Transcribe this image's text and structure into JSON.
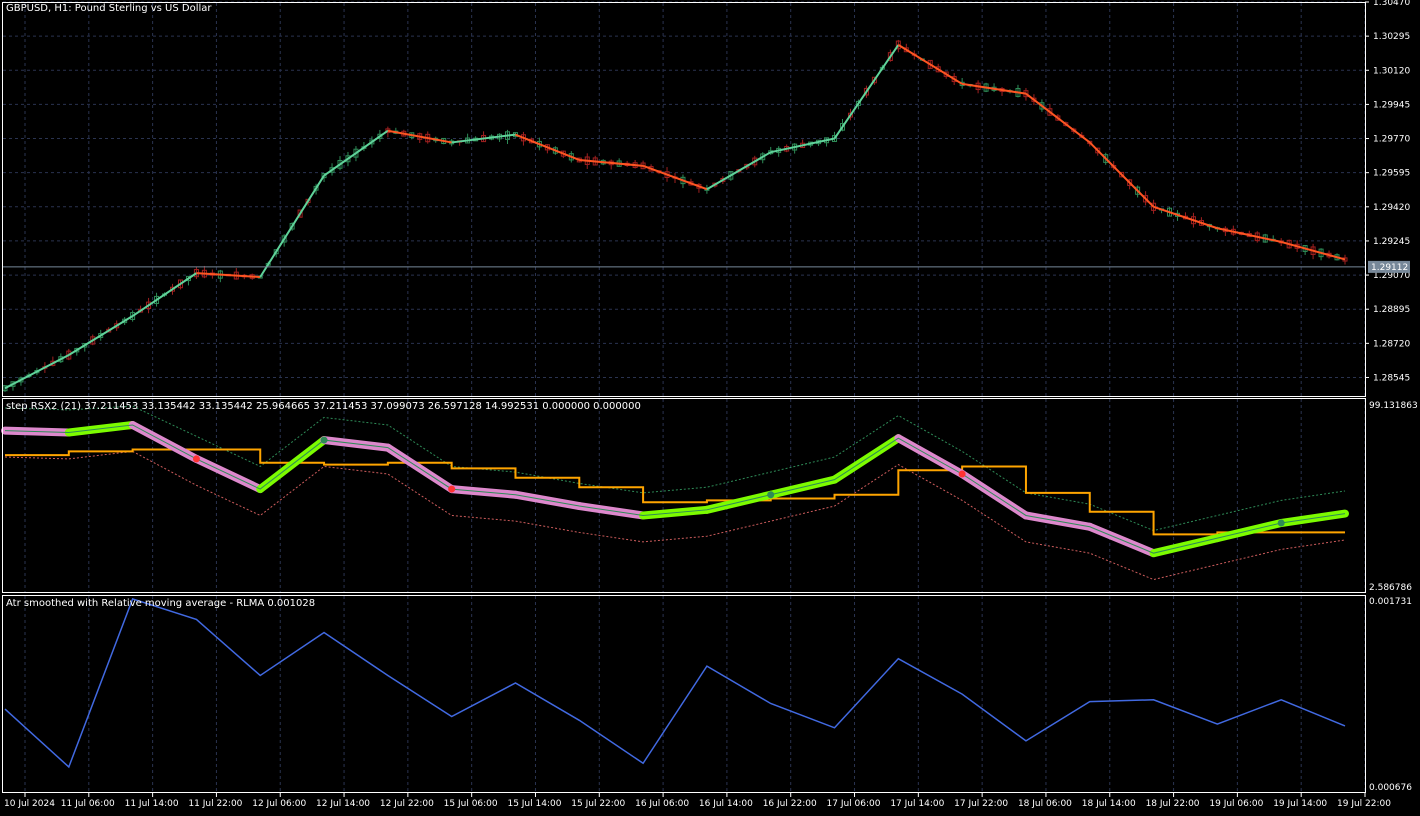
{
  "colors": {
    "background": "#000000",
    "border": "#ffffff",
    "grid": "#2a3350",
    "bull_candle": "#2e8b57",
    "bear_candle": "#a02020",
    "ma_up": "#5fd39a",
    "ma_down": "#ff5522",
    "price_line": "#778899",
    "rsx_up": "#7cfc00",
    "rsx_down": "#dd88cc",
    "rsx_line": "#2e8b57",
    "signal": "#ffa500",
    "band_upper": "#2e8b57",
    "band_lower": "#cd5c5c",
    "dot_up": "#2e8b57",
    "dot_down": "#ff3333",
    "atr_line": "#4169e1"
  },
  "main_pane": {
    "title": "GBPUSD, H1:  Pound Sterling vs US Dollar",
    "price_ticks": [
      "1.30470",
      "1.30295",
      "1.30120",
      "1.29945",
      "1.29770",
      "1.29595",
      "1.29420",
      "1.29245",
      "1.29070",
      "1.28895",
      "1.28720",
      "1.28545"
    ],
    "current_price": "1.29112"
  },
  "rsx_pane": {
    "title": "step RSX2 (21) 37.211453 33.135442 33.135442 25.964665 37.211453 37.099073 26.597128 14.992531 0.000000 0.000000",
    "max_label": "99.131863",
    "min_label": "2.586786"
  },
  "atr_pane": {
    "title": "Atr smoothed with Relative moving average - RLMA 0.001028",
    "max_label": "0.001731",
    "min_label": "0.000676"
  },
  "time_axis": {
    "labels": [
      "10 Jul 2024",
      "11 Jul 06:00",
      "11 Jul 14:00",
      "11 Jul 22:00",
      "12 Jul 06:00",
      "12 Jul 14:00",
      "12 Jul 22:00",
      "15 Jul 06:00",
      "15 Jul 14:00",
      "15 Jul 22:00",
      "16 Jul 06:00",
      "16 Jul 14:00",
      "16 Jul 22:00",
      "17 Jul 06:00",
      "17 Jul 14:00",
      "17 Jul 22:00",
      "18 Jul 06:00",
      "18 Jul 14:00",
      "18 Jul 22:00",
      "19 Jul 06:00",
      "19 Jul 14:00",
      "19 Jul 22:00"
    ]
  },
  "chart_data": [
    {
      "type": "line",
      "title": "GBPUSD, H1:  Pound Sterling vs US Dollar",
      "description": "candlestick price with smoothed moving average",
      "x": [
        "10 Jul 2024",
        "11 Jul 06:00",
        "11 Jul 14:00",
        "11 Jul 22:00",
        "12 Jul 06:00",
        "12 Jul 14:00",
        "12 Jul 22:00",
        "15 Jul 06:00",
        "15 Jul 14:00",
        "15 Jul 22:00",
        "16 Jul 06:00",
        "16 Jul 14:00",
        "16 Jul 22:00",
        "17 Jul 06:00",
        "17 Jul 14:00",
        "17 Jul 22:00",
        "18 Jul 06:00",
        "18 Jul 14:00",
        "18 Jul 22:00",
        "19 Jul 06:00",
        "19 Jul 14:00",
        "19 Jul 22:00"
      ],
      "series": [
        {
          "name": "",
          "values": [
            1.2849,
            1.2866,
            1.2886,
            1.2908,
            1.2906,
            1.2958,
            1.2981,
            1.2975,
            1.2979,
            1.2966,
            1.2963,
            1.2951,
            1.297,
            1.2977,
            1.3025,
            1.3005,
            1.3,
            1.2975,
            1.2942,
            1.2931,
            1.2924,
            1.2915
          ]
        }
      ],
      "ylim": [
        1.2845,
        1.3047
      ]
    },
    {
      "type": "line",
      "title": "step RSX2 (21)",
      "x": [
        "10 Jul 2024",
        "11 Jul 06:00",
        "11 Jul 14:00",
        "11 Jul 22:00",
        "12 Jul 06:00",
        "12 Jul 14:00",
        "12 Jul 22:00",
        "15 Jul 06:00",
        "15 Jul 14:00",
        "15 Jul 22:00",
        "16 Jul 06:00",
        "16 Jul 14:00",
        "16 Jul 22:00",
        "17 Jul 06:00",
        "17 Jul 14:00",
        "17 Jul 22:00",
        "18 Jul 06:00",
        "18 Jul 14:00",
        "18 Jul 22:00",
        "19 Jul 06:00",
        "19 Jul 14:00",
        "19 Jul 22:00"
      ],
      "series": [
        {
          "name": "",
          "values": [
            85,
            84,
            88,
            70,
            54,
            80,
            76,
            54,
            51,
            45,
            40,
            43,
            51,
            59,
            81,
            62,
            40,
            34,
            20,
            28,
            36,
            41
          ]
        },
        {
          "name": "",
          "values": [
            72,
            74,
            75,
            75,
            68,
            67,
            68,
            65,
            60,
            55,
            47,
            48,
            49,
            51,
            64,
            66,
            52,
            42,
            30,
            31,
            31,
            31
          ]
        }
      ],
      "ylim": [
        2.586786,
        99.131863
      ]
    },
    {
      "type": "line",
      "title": "Atr smoothed with Relative moving average - RLMA",
      "x": [
        "10 Jul 2024",
        "11 Jul 06:00",
        "11 Jul 14:00",
        "11 Jul 22:00",
        "12 Jul 06:00",
        "12 Jul 14:00",
        "12 Jul 22:00",
        "15 Jul 06:00",
        "15 Jul 14:00",
        "15 Jul 22:00",
        "16 Jul 06:00",
        "16 Jul 14:00",
        "16 Jul 22:00",
        "17 Jul 06:00",
        "17 Jul 14:00",
        "17 Jul 22:00",
        "18 Jul 06:00",
        "18 Jul 14:00",
        "18 Jul 22:00",
        "19 Jul 06:00",
        "19 Jul 14:00",
        "19 Jul 22:00"
      ],
      "series": [
        {
          "name": "",
          "values": [
            0.00112,
            0.00081,
            0.00171,
            0.0016,
            0.0013,
            0.00153,
            0.0013,
            0.00108,
            0.00126,
            0.00106,
            0.00083,
            0.00135,
            0.00115,
            0.00102,
            0.00139,
            0.0012,
            0.00095,
            0.00116,
            0.00117,
            0.00104,
            0.00117,
            0.00103
          ]
        }
      ],
      "ylim": [
        0.000676,
        0.001731
      ]
    }
  ]
}
